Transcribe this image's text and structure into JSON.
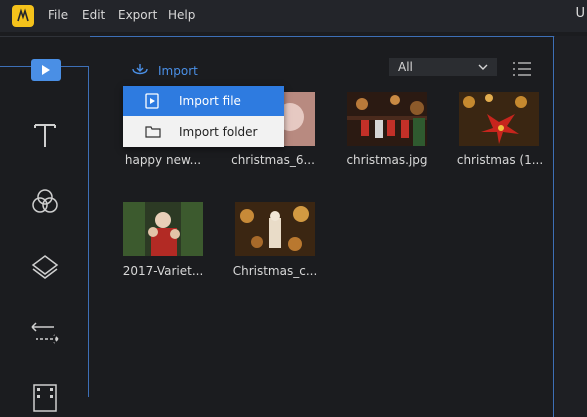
{
  "menubar": {
    "items": [
      "File",
      "Edit",
      "Export",
      "Help"
    ],
    "title_fragment": "U"
  },
  "toolrail": {
    "tools": [
      "media-icon",
      "text-icon",
      "filters-icon",
      "overlays-icon",
      "transitions-icon",
      "elements-icon"
    ]
  },
  "media": {
    "import_label": "Import",
    "filter_value": "All",
    "import_menu": {
      "import_file": "Import file",
      "import_folder": "Import folder"
    },
    "items": [
      {
        "label": "happy new..."
      },
      {
        "label": "christmas_6..."
      },
      {
        "label": "christmas.jpg"
      },
      {
        "label": "christmas (1..."
      },
      {
        "label": "2017-Variet..."
      },
      {
        "label": "Christmas_c..."
      }
    ]
  },
  "colors": {
    "accent": "#4a8fe5",
    "menu_highlight": "#2e7be0",
    "background": "#1b1c1f"
  }
}
